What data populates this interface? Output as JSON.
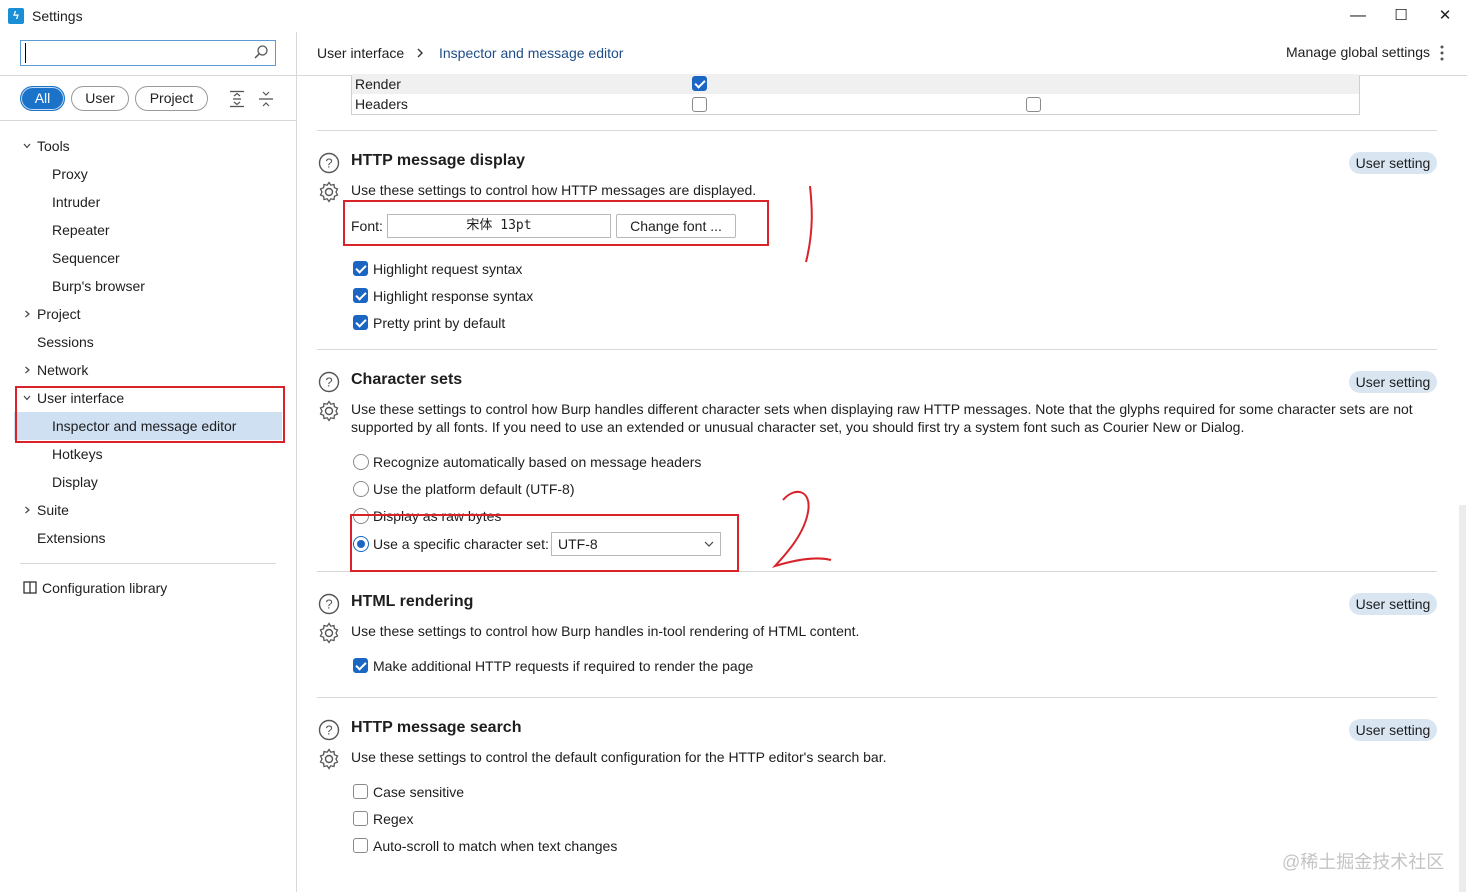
{
  "window": {
    "title": "Settings",
    "icon": "burp-logo-icon",
    "minimize": "—",
    "maximize": "☐",
    "close": "✕"
  },
  "sidebar": {
    "search": {
      "value": "",
      "placeholder": ""
    },
    "filters": [
      {
        "label": "All",
        "active": true
      },
      {
        "label": "User",
        "active": false
      },
      {
        "label": "Project",
        "active": false
      }
    ],
    "tree": {
      "tools": "Tools",
      "proxy": "Proxy",
      "intruder": "Intruder",
      "repeater": "Repeater",
      "sequencer": "Sequencer",
      "burps_browser": "Burp's browser",
      "project": "Project",
      "sessions": "Sessions",
      "network": "Network",
      "user_interface": "User interface",
      "inspector": "Inspector and message editor",
      "hotkeys": "Hotkeys",
      "display": "Display",
      "suite": "Suite",
      "extensions": "Extensions"
    },
    "config_library": "Configuration library"
  },
  "header": {
    "breadcrumb": [
      "User interface",
      "Inspector and message editor"
    ],
    "manage_global": "Manage global settings"
  },
  "render_table": {
    "rows": [
      {
        "label": "Render",
        "col1_checked": true,
        "col2_checked": null
      },
      {
        "label": "Headers",
        "col1_checked": false,
        "col2_checked": false
      }
    ]
  },
  "sections": {
    "http_display": {
      "title": "HTTP message display",
      "badge": "User setting",
      "desc": "Use these settings to control how HTTP messages are displayed.",
      "font_label": "Font:",
      "font_value": "宋体 13pt",
      "change_font": "Change font ...",
      "options": [
        {
          "label": "Highlight request syntax",
          "checked": true
        },
        {
          "label": "Highlight response syntax",
          "checked": true
        },
        {
          "label": "Pretty print by default",
          "checked": true
        }
      ]
    },
    "charsets": {
      "title": "Character sets",
      "badge": "User setting",
      "desc": "Use these settings to control how Burp handles different character sets when displaying raw HTTP messages. Note that the glyphs required for some character sets are not supported by all fonts. If you need to use an extended or unusual character set, you should first try a system font such as Courier New or Dialog.",
      "options": [
        {
          "label": "Recognize automatically based on message headers",
          "selected": false
        },
        {
          "label": "Use the platform default (UTF-8)",
          "selected": false
        },
        {
          "label": "Display as raw bytes",
          "selected": false
        },
        {
          "label": "Use a specific character set:",
          "selected": true
        }
      ],
      "select_value": "UTF-8"
    },
    "html_rendering": {
      "title": "HTML rendering",
      "badge": "User setting",
      "desc": "Use these settings to control how Burp handles in-tool rendering of HTML content.",
      "options": [
        {
          "label": "Make additional HTTP requests if required to render the page",
          "checked": true
        }
      ]
    },
    "http_search": {
      "title": "HTTP message search",
      "badge": "User setting",
      "desc": "Use these settings to control the default configuration for the HTTP editor's search bar.",
      "options": [
        {
          "label": "Case sensitive",
          "checked": false
        },
        {
          "label": "Regex",
          "checked": false
        },
        {
          "label": "Auto-scroll to match when text changes",
          "checked": false
        }
      ]
    }
  },
  "watermark": "@稀土掘金技术社区",
  "colors": {
    "accent": "#1a66c2",
    "annotation": "#d8232a",
    "selection": "#cfe0f3",
    "badge": "#d9e6f2"
  }
}
